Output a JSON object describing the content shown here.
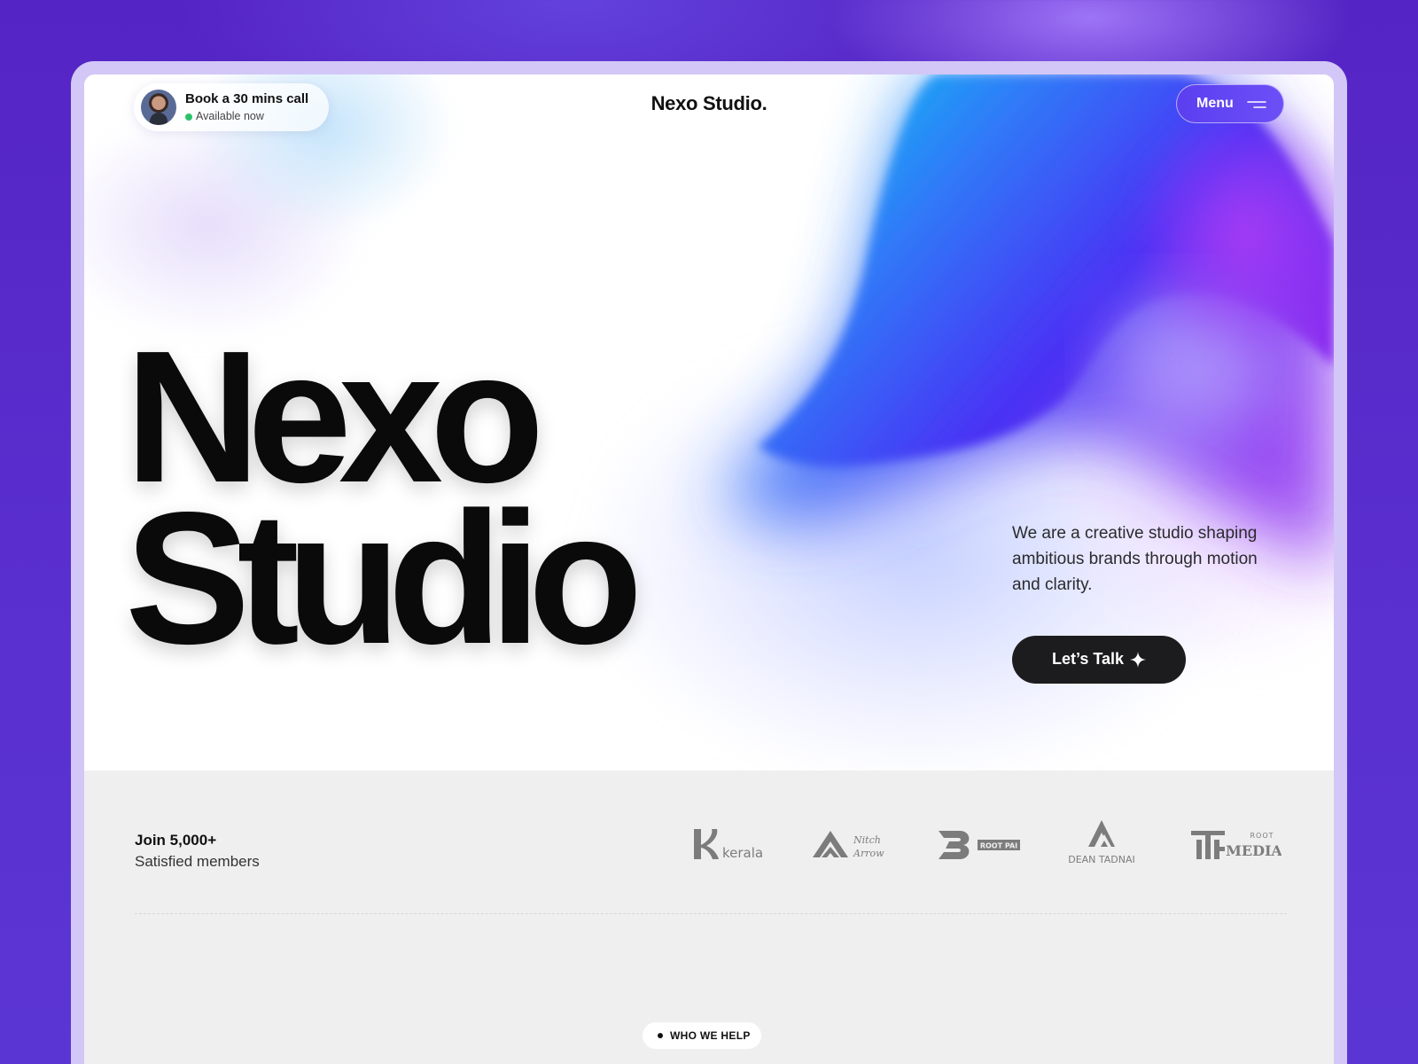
{
  "header": {
    "call": {
      "title": "Book a 30 mins call",
      "status": "Available now"
    },
    "brand": "Nexo Studio.",
    "menu_label": "Menu"
  },
  "hero": {
    "headline_line1": "Nexo",
    "headline_line2": "Studio",
    "tagline": "We are a creative studio shaping ambitious brands through motion and clarity.",
    "cta_label": "Let’s Talk"
  },
  "social_proof": {
    "title": "Join 5,000+",
    "subtitle": "Satisfied members",
    "logos": [
      {
        "name": "kerala",
        "text": "kerala"
      },
      {
        "name": "nitch-arrow",
        "text": "Nitch Arrow"
      },
      {
        "name": "root-pai",
        "text": "ROOT PAI"
      },
      {
        "name": "dean-tadnai",
        "text": "DEAN TADNAI"
      },
      {
        "name": "root-media",
        "text": "ROOT MEDIA"
      }
    ]
  },
  "section": {
    "eyebrow": "WHO WE HELP"
  },
  "colors": {
    "background": "#5524c4",
    "frame": "#d2c7f6",
    "menu_button": "#5b3ff0",
    "cta_button": "#1c1c1e",
    "status_available": "#2ac36a",
    "lower_section": "#efefef"
  },
  "icons": [
    "avatar-photo",
    "status-dot",
    "menu-lines-icon",
    "sparkle-icon"
  ]
}
